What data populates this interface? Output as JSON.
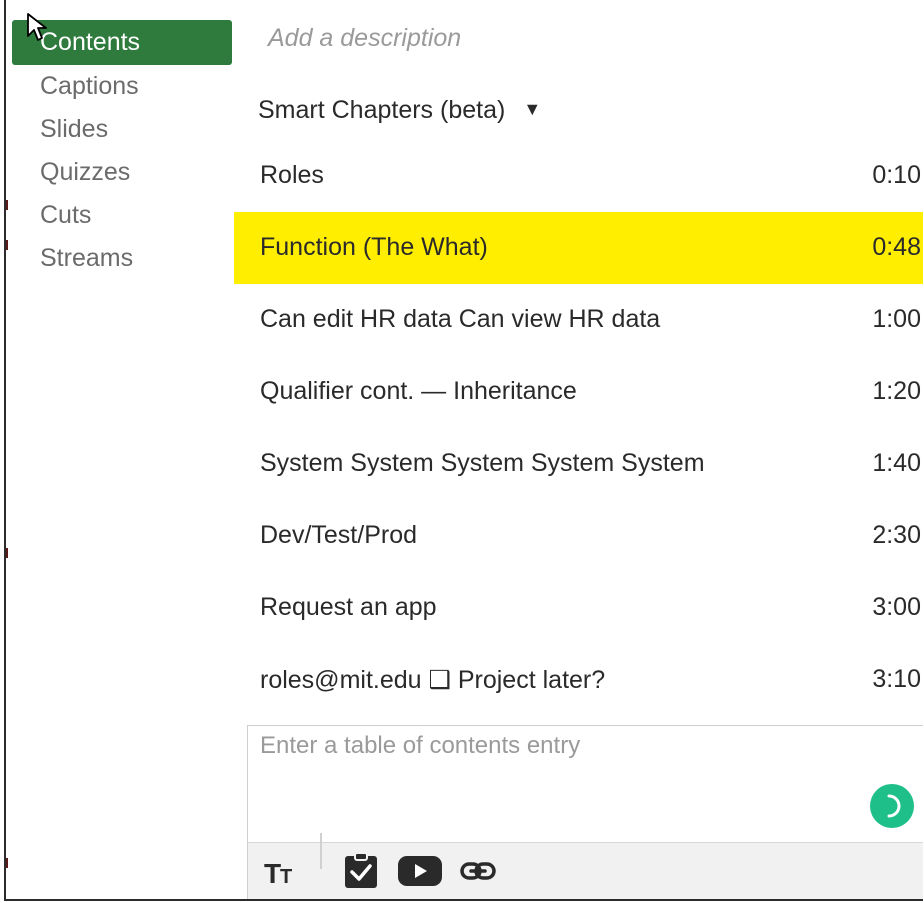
{
  "sidebar": {
    "items": [
      {
        "label": "Contents",
        "active": true
      },
      {
        "label": "Captions",
        "active": false
      },
      {
        "label": "Slides",
        "active": false
      },
      {
        "label": "Quizzes",
        "active": false
      },
      {
        "label": "Cuts",
        "active": false
      },
      {
        "label": "Streams",
        "active": false
      }
    ]
  },
  "description": {
    "placeholder": "Add a description"
  },
  "chapters": {
    "dropdown_label": "Smart Chapters (beta)",
    "rows": [
      {
        "title": "Roles",
        "time": "0:10",
        "highlighted": false
      },
      {
        "title": "Function (The What)",
        "time": "0:48",
        "highlighted": true
      },
      {
        "title": "Can edit HR data Can view HR data",
        "time": "1:00",
        "highlighted": false
      },
      {
        "title": "Qualifier cont. — Inheritance",
        "time": "1:20",
        "highlighted": false
      },
      {
        "title": "System System System System System",
        "time": "1:40",
        "highlighted": false
      },
      {
        "title": "Dev/Test/Prod",
        "time": "2:30",
        "highlighted": false
      },
      {
        "title": "Request an app",
        "time": "3:00",
        "highlighted": false
      },
      {
        "title": "roles@mit.edu ❑ Project later?",
        "time": "3:10",
        "highlighted": false
      }
    ]
  },
  "entry": {
    "placeholder": "Enter a table of contents entry",
    "value": ""
  },
  "toolbar": {
    "tools": [
      "text-size-icon",
      "checkbox-icon",
      "video-icon",
      "link-icon"
    ]
  },
  "colors": {
    "active_nav": "#2f7a3d",
    "highlight": "#ffee00",
    "submit": "#1fbf8a"
  }
}
